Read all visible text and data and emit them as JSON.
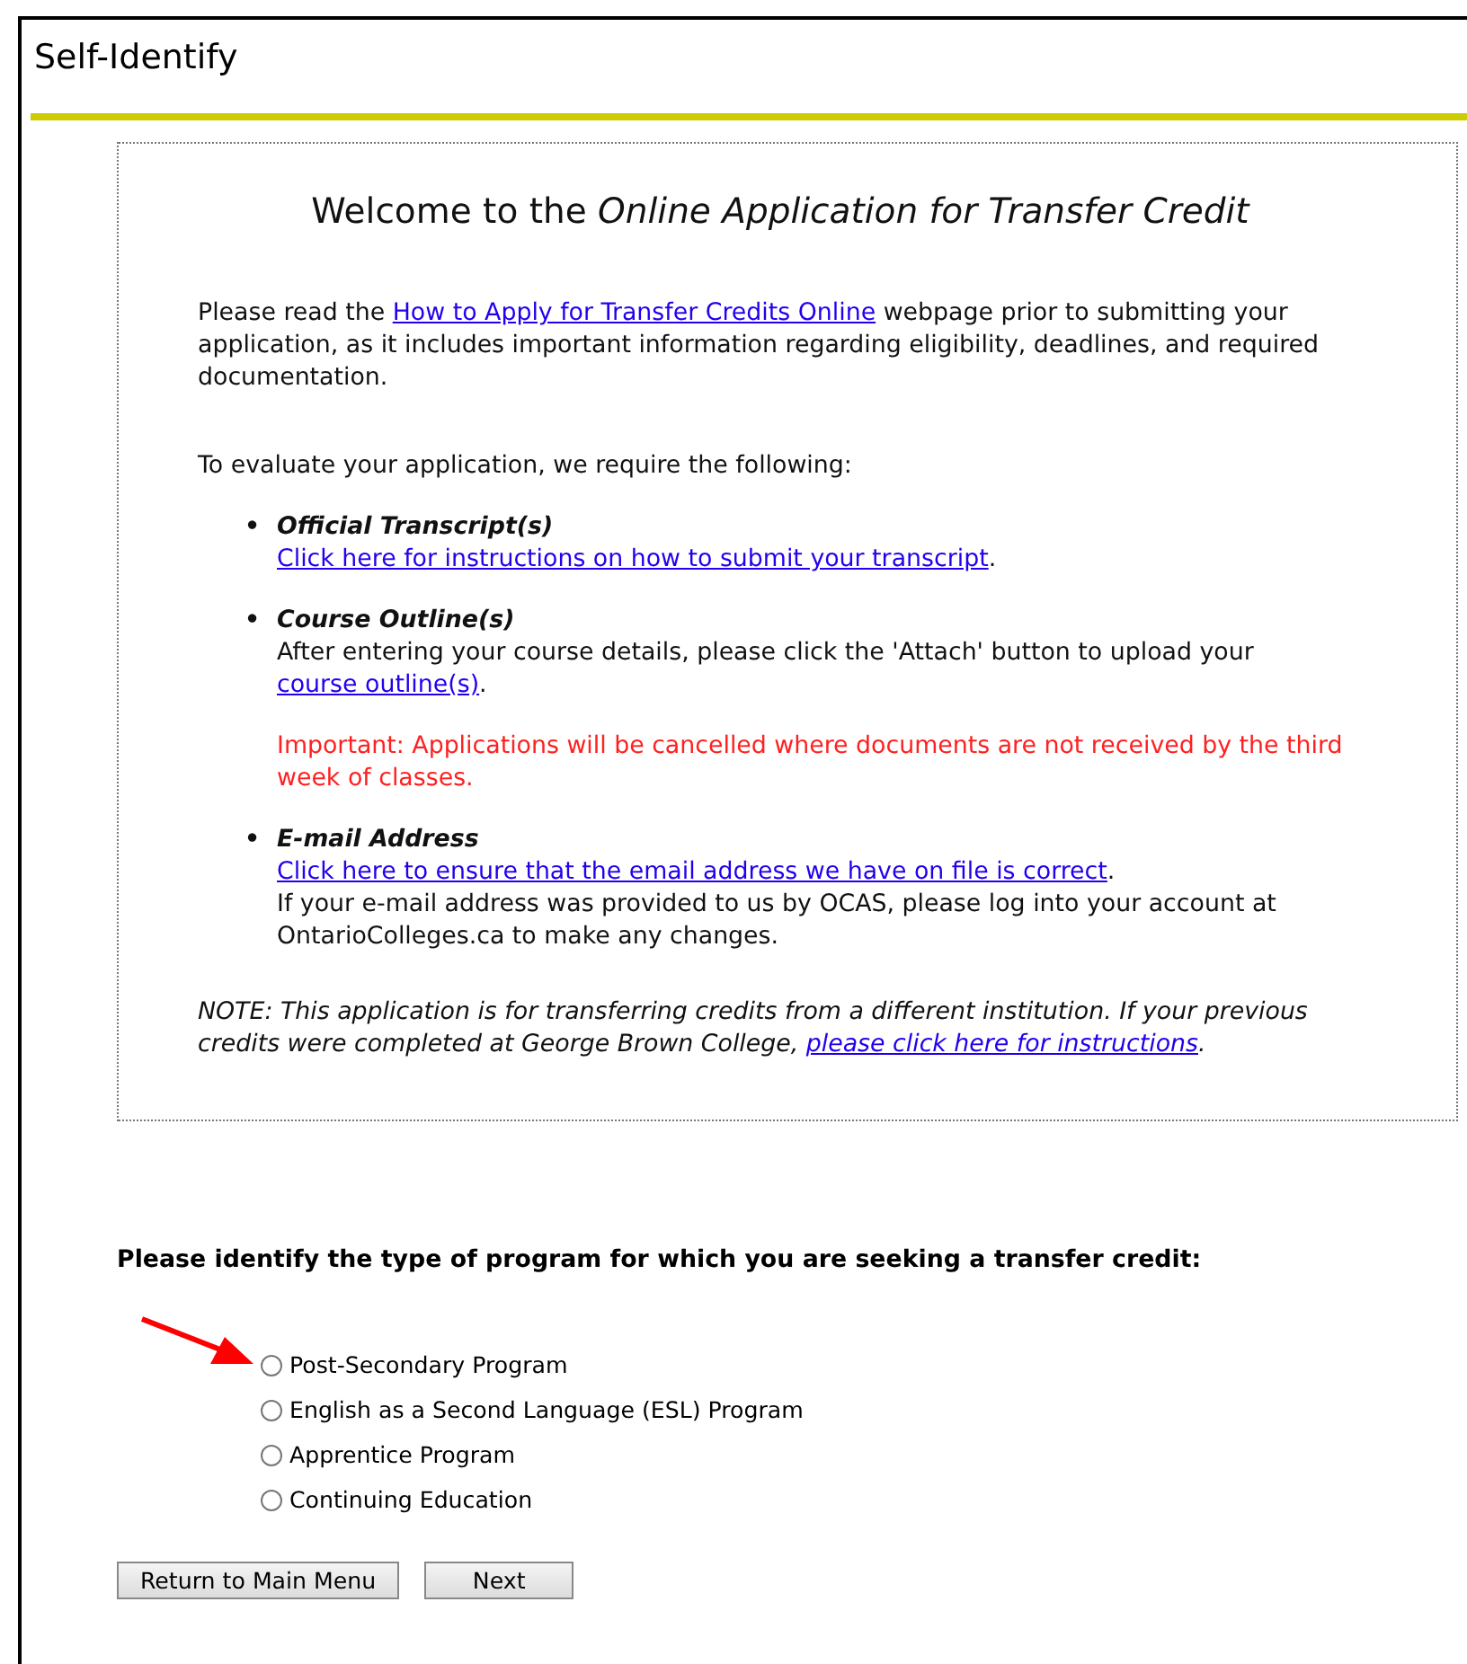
{
  "page_title": "Self-Identify",
  "welcome": {
    "heading": "Welcome to the *Online Application for Transfer Credit*",
    "intro": [
      {
        "kind": "text",
        "text": "Please read the "
      },
      {
        "kind": "link",
        "text": "How to Apply for Transfer Credits Online"
      },
      {
        "kind": "text",
        "text": " webpage prior to submitting your application, as it includes important information regarding eligibility, deadlines, and required documentation."
      }
    ],
    "requirements_lead": "To evaluate your application, we require the following:",
    "requirements": [
      {
        "bullet": "•",
        "title": "Official Transcript(s)",
        "paragraphs": [
          {
            "kind": "normal",
            "segments": [
              {
                "kind": "link",
                "text": "Click here for instructions on how to submit your transcript"
              },
              {
                "kind": "text",
                "text": "."
              }
            ]
          }
        ]
      },
      {
        "bullet": "•",
        "title": "Course Outline(s)",
        "paragraphs": [
          {
            "kind": "normal",
            "segments": [
              {
                "kind": "text",
                "text": "After entering your course details, please click the 'Attach' button to upload your "
              },
              {
                "kind": "link",
                "text": "course outline(s)"
              },
              {
                "kind": "text",
                "text": "."
              }
            ]
          },
          {
            "kind": "warning",
            "segments": [
              {
                "kind": "text",
                "text": "Important: Applications will be cancelled where documents are not received by the third week of classes."
              }
            ]
          }
        ]
      },
      {
        "bullet": "•",
        "title": "E-mail Address",
        "paragraphs": [
          {
            "kind": "normal",
            "segments": [
              {
                "kind": "link",
                "text": "Click here to ensure that the email address we have on file is correct"
              },
              {
                "kind": "text",
                "text": "."
              }
            ]
          },
          {
            "kind": "tight",
            "segments": [
              {
                "kind": "text",
                "text": "If your e-mail address was provided to us by OCAS, please log into your account at OntarioColleges.ca to make any changes."
              }
            ]
          }
        ]
      }
    ],
    "note": [
      {
        "kind": "text",
        "text": "NOTE: This application is for transferring credits from a different institution. If your previous credits were completed at George Brown College, "
      },
      {
        "kind": "link",
        "text": "please click here for instructions"
      },
      {
        "kind": "text",
        "text": "."
      }
    ]
  },
  "program_question": "Please identify the type of program for which you are seeking a transfer credit:",
  "program_options": [
    {
      "label": "Post-Secondary Program",
      "selected": false
    },
    {
      "label": "English as a Second Language (ESL) Program",
      "selected": false
    },
    {
      "label": "Apprentice Program",
      "selected": false
    },
    {
      "label": "Continuing Education",
      "selected": false
    }
  ],
  "buttons": [
    "Return to Main Menu",
    "Next"
  ]
}
